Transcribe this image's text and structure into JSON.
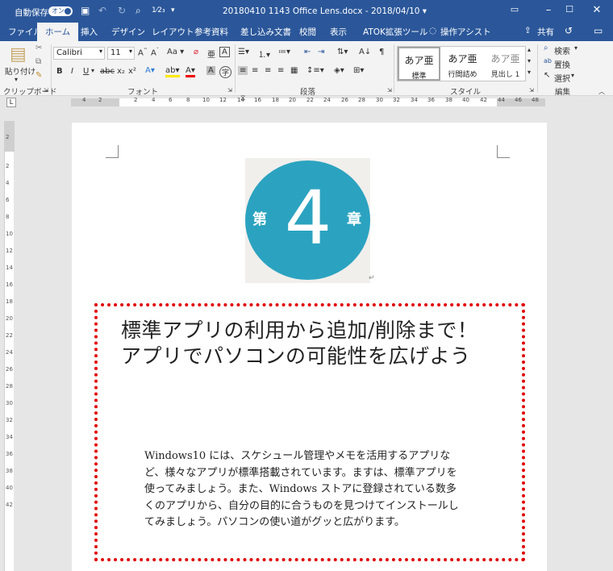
{
  "titlebar": {
    "autosave_label": "自動保存",
    "autosave_state": "オン",
    "document_title": "20180410 1143 Office Lens.docx  -  2018/04/10 ▾"
  },
  "tabs": [
    {
      "label": "ファイル"
    },
    {
      "label": "ホーム"
    },
    {
      "label": "挿入"
    },
    {
      "label": "デザイン"
    },
    {
      "label": "レイアウト"
    },
    {
      "label": "参考資料"
    },
    {
      "label": "差し込み文書"
    },
    {
      "label": "校閲"
    },
    {
      "label": "表示"
    },
    {
      "label": "ATOK拡張ツール"
    }
  ],
  "tell_me": "操作アシスト",
  "share_label": "共有",
  "ribbon": {
    "clipboard": {
      "paste_label": "貼り付け",
      "group_label": "クリップボード"
    },
    "font": {
      "name": "Calibri",
      "size": "11",
      "group_label": "フォント",
      "aa_label": "Aa"
    },
    "paragraph": {
      "group_label": "段落"
    },
    "styles": {
      "group_label": "スタイル",
      "items": [
        {
          "sample": "あア亜",
          "name": "標準"
        },
        {
          "sample": "あア亜",
          "name": "行間詰め"
        },
        {
          "sample": "あア亜",
          "name": "見出し 1"
        }
      ]
    },
    "editing": {
      "group_label": "編集",
      "find": "検索",
      "replace": "置換",
      "select": "選択"
    }
  },
  "ruler": {
    "h_ticks": [
      "4",
      "2",
      "2",
      "4",
      "6",
      "8",
      "10",
      "12",
      "14",
      "16",
      "18",
      "20",
      "22",
      "24",
      "26",
      "28",
      "30",
      "32",
      "34",
      "36",
      "38",
      "40",
      "42",
      "44",
      "46",
      "48"
    ],
    "v_ticks": [
      "2",
      "2",
      "4",
      "6",
      "8",
      "10",
      "12",
      "14",
      "16",
      "18",
      "20",
      "22",
      "24",
      "26",
      "28",
      "30",
      "32",
      "34",
      "36",
      "38",
      "40",
      "42"
    ]
  },
  "document": {
    "chapter_image": {
      "left_kanji": "第",
      "number": "4",
      "right_kanji": "章"
    },
    "heading": "標準アプリの利用から追加/削除まで！ アプリでパソコンの可能性を広げよう",
    "body": "Windows10 には、スケシュール管理やメモを活用するアプリなど、様々なアプリが標準搭載されています。ますは、標準アプリを使ってみましょう。また、Windows ストアに登録されている数多くのアプリから、自分の目的に合うものを見つけてインストールしてみましょう。パソコンの使い道がグッと広がります。"
  },
  "colors": {
    "accent": "#2b579a",
    "chapter_circle": "#2ba3c0",
    "frame": "#e00000"
  }
}
